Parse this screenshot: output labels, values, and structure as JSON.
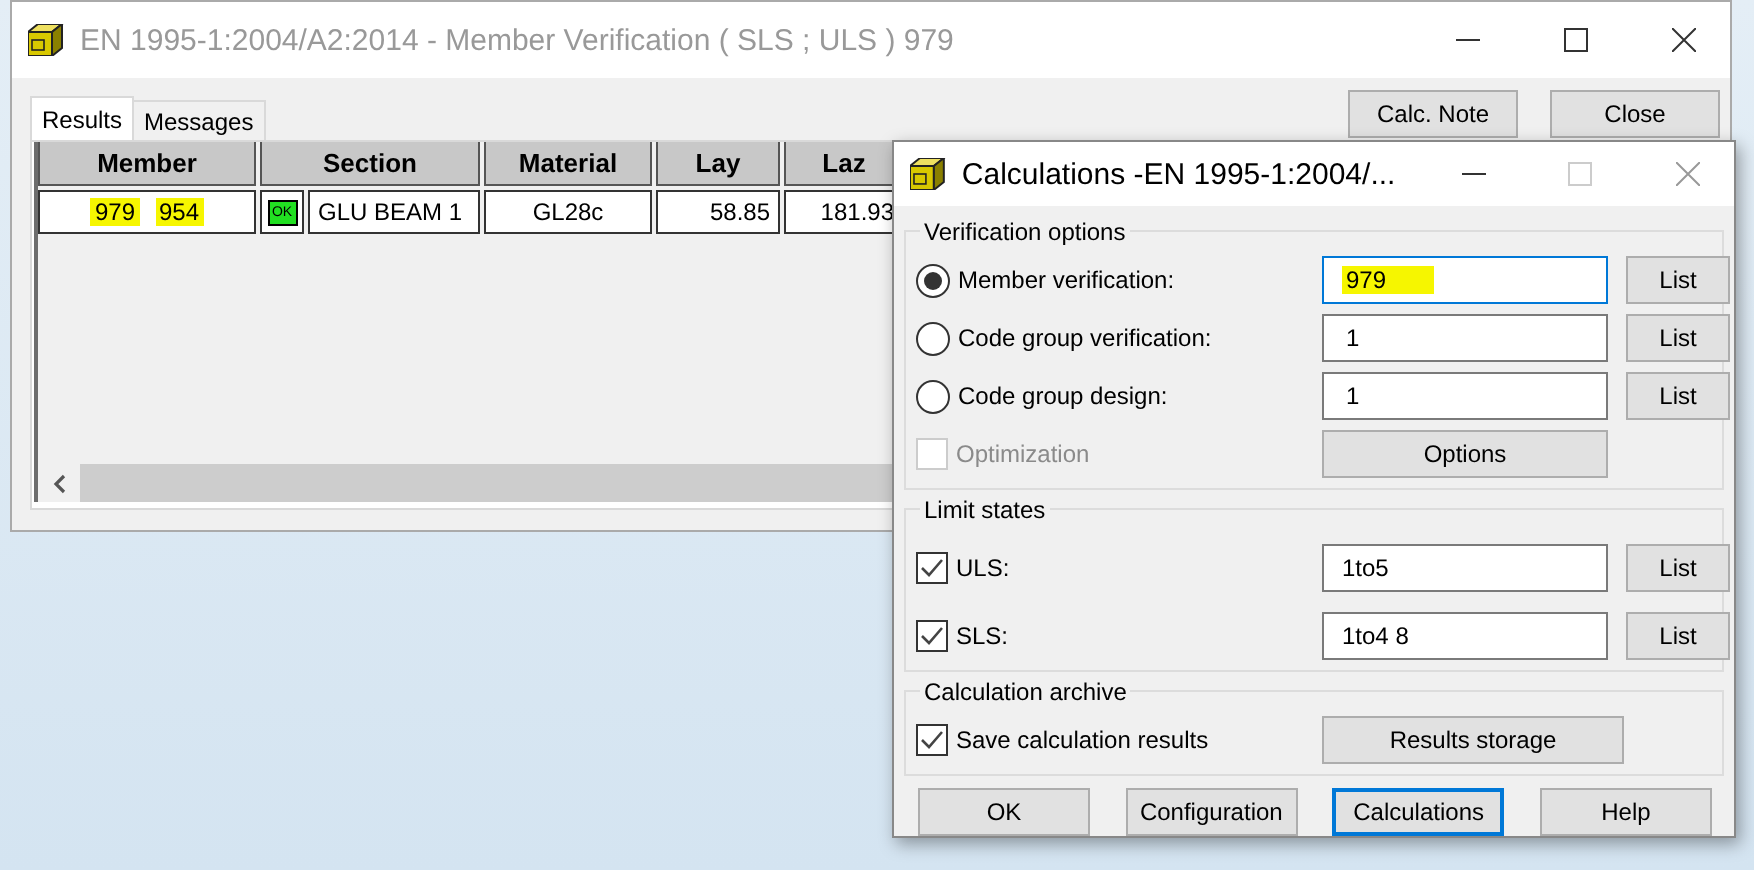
{
  "main_window": {
    "title": "EN 1995-1:2004/A2:2014 - Member Verification ( SLS ; ULS ) 979",
    "tabs": [
      {
        "label": "Results",
        "selected": true
      },
      {
        "label": "Messages",
        "selected": false
      }
    ],
    "buttons": [
      "Calc. Note",
      "Close"
    ],
    "table": {
      "columns": [
        "Member",
        "Section",
        "Material",
        "Lay",
        "Laz"
      ],
      "rows": [
        {
          "member": [
            {
              "text": "979",
              "highlighted": true
            },
            {
              "text": "954",
              "highlighted": true
            }
          ],
          "status": "OK",
          "section": "GLU BEAM 1",
          "material": "GL28c",
          "lay": "58.85",
          "laz": "181.93"
        }
      ]
    }
  },
  "dialog": {
    "title": "Calculations -EN 1995-1:2004/...",
    "verification": {
      "title": "Verification options",
      "options": [
        {
          "label": "Member verification:",
          "selected": true,
          "value": "979",
          "highlighted": true,
          "focused": true,
          "button": "List"
        },
        {
          "label": "Code group verification:",
          "selected": false,
          "value": "1",
          "highlighted": false,
          "focused": false,
          "button": "List"
        },
        {
          "label": "Code group design:",
          "selected": false,
          "value": "1",
          "highlighted": false,
          "focused": false,
          "button": "List"
        }
      ],
      "optimization": {
        "label": "Optimization",
        "checked": false,
        "disabled": true
      },
      "options_button": "Options"
    },
    "limit_states": {
      "title": "Limit states",
      "items": [
        {
          "label": "ULS:",
          "checked": true,
          "value": "1to5",
          "button": "List"
        },
        {
          "label": "SLS:",
          "checked": true,
          "value": "1to4 8",
          "button": "List"
        }
      ]
    },
    "archive": {
      "title": "Calculation archive",
      "checkbox": {
        "label": "Save calculation results",
        "checked": true
      },
      "button": "Results storage"
    },
    "buttons": [
      {
        "label": "OK",
        "focused": false
      },
      {
        "label": "Configuration",
        "focused": false
      },
      {
        "label": "Calculations",
        "focused": true
      },
      {
        "label": "Help",
        "focused": false
      }
    ]
  }
}
